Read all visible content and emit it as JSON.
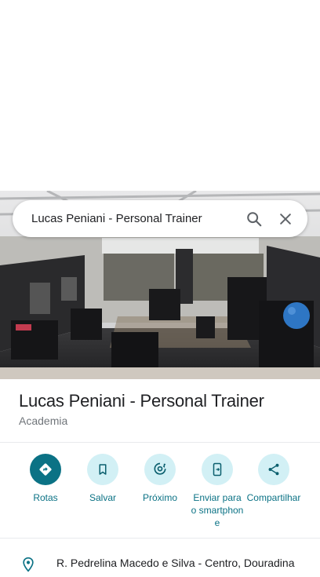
{
  "search": {
    "query": "Lucas Peniani - Personal Trainer"
  },
  "place": {
    "name": "Lucas Peniani - Personal Trainer",
    "category": "Academia",
    "address": "R. Pedrelina Macedo e Silva - Centro, Douradina"
  },
  "actions": [
    {
      "label": "Rotas",
      "icon": "directions-icon"
    },
    {
      "label": "Salvar",
      "icon": "bookmark-icon"
    },
    {
      "label": "Próximo",
      "icon": "nearby-icon"
    },
    {
      "label": "Enviar para o smartphone",
      "icon": "send-to-phone-icon"
    },
    {
      "label": "Compartilhar",
      "icon": "share-icon"
    }
  ],
  "colors": {
    "accent": "#0b7285",
    "accent_light": "#d2f0f5",
    "text": "#202124",
    "secondary_text": "#70757a"
  }
}
